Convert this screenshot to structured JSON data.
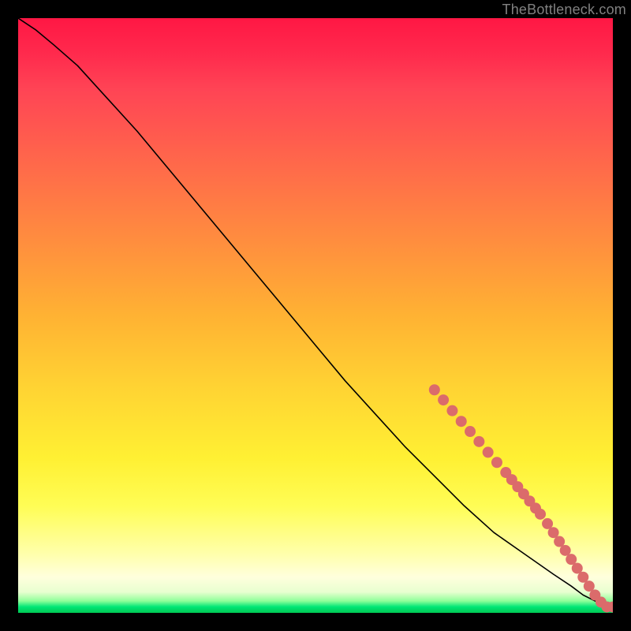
{
  "attribution": "TheBottleneck.com",
  "chart_data": {
    "type": "line",
    "title": "",
    "xlabel": "",
    "ylabel": "",
    "xlim": [
      0,
      100
    ],
    "ylim": [
      0,
      100
    ],
    "grid": false,
    "series": [
      {
        "name": "bottleneck-curve",
        "x": [
          0,
          3,
          6,
          10,
          15,
          20,
          25,
          30,
          35,
          40,
          45,
          50,
          55,
          60,
          65,
          70,
          75,
          80,
          85,
          90,
          93,
          95,
          97,
          98.5,
          100
        ],
        "y": [
          100,
          98,
          95.5,
          92,
          86.5,
          81,
          75,
          69,
          63,
          57,
          51,
          45,
          39,
          33.5,
          28,
          23,
          18,
          13.5,
          10,
          6.5,
          4.5,
          3,
          2,
          1.3,
          1
        ]
      }
    ],
    "points": {
      "name": "highlight-points",
      "color": "#db6b6b",
      "x": [
        70,
        71.5,
        73,
        74.5,
        76,
        77.5,
        79,
        80.5,
        82,
        83,
        84,
        85,
        86,
        87,
        87.8,
        89,
        90,
        91,
        92,
        93,
        94,
        95,
        96,
        97,
        98,
        99,
        100
      ],
      "y": [
        37.5,
        35.8,
        34,
        32.2,
        30.5,
        28.8,
        27,
        25.3,
        23.6,
        22.4,
        21.2,
        20,
        18.8,
        17.6,
        16.6,
        15,
        13.5,
        12,
        10.5,
        9,
        7.5,
        6,
        4.5,
        3,
        1.8,
        1,
        1
      ]
    }
  }
}
